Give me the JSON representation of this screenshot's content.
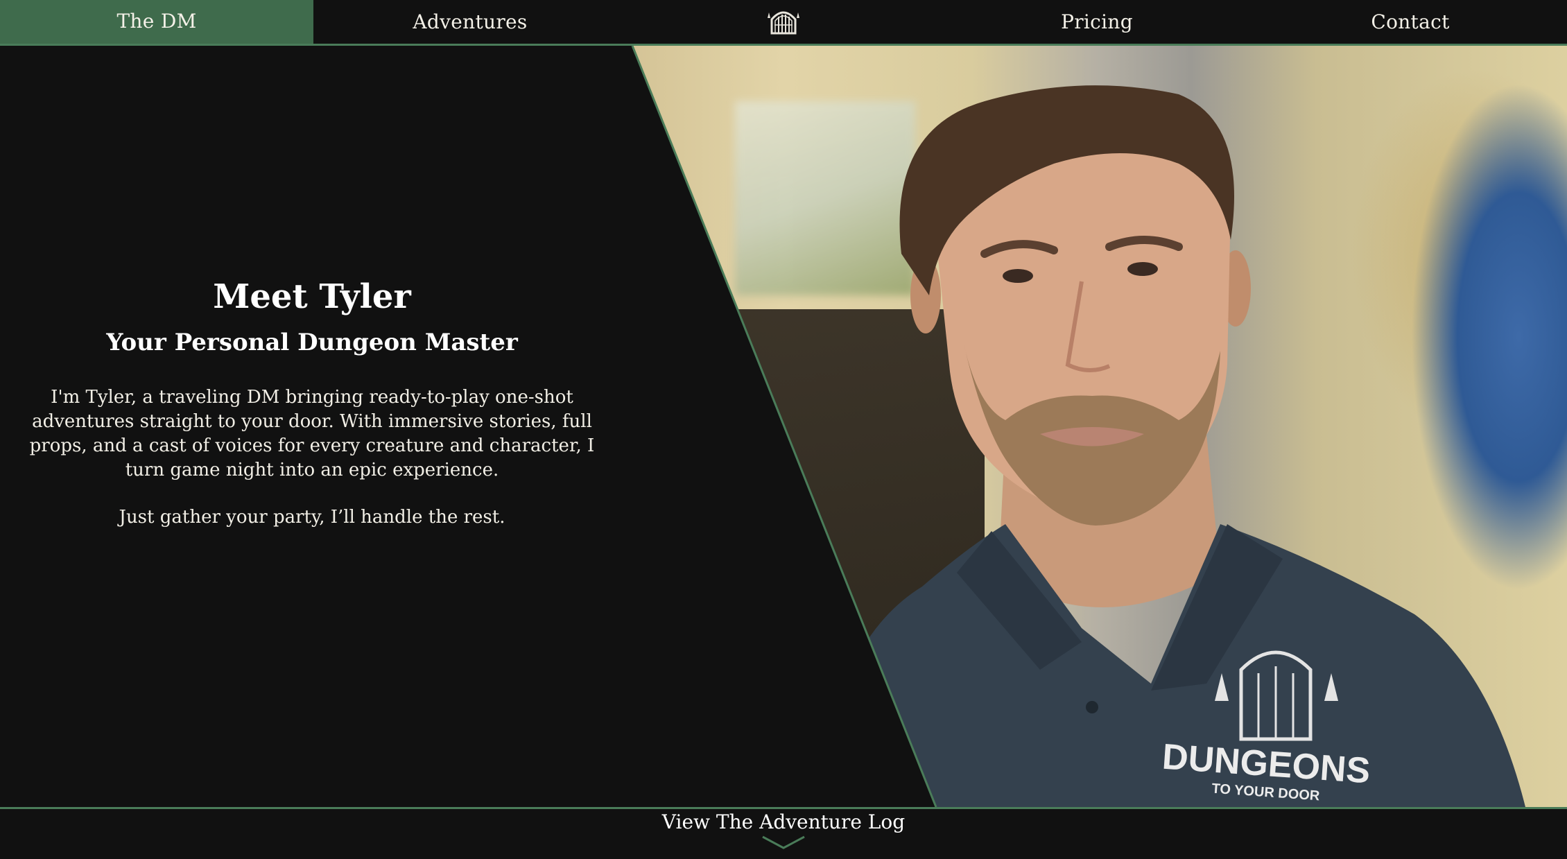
{
  "nav": {
    "items": [
      {
        "label": "The DM",
        "active": true
      },
      {
        "label": "Adventures",
        "active": false
      },
      {
        "label": "Pricing",
        "active": false
      },
      {
        "label": "Contact",
        "active": false
      }
    ],
    "logo_icon": "dungeon-door-icon"
  },
  "hero": {
    "title": "Meet Tyler",
    "subtitle": "Your Personal Dungeon Master",
    "body": "I'm Tyler, a traveling DM bringing ready-to-play one-shot adventures straight to your door. With immersive stories, full props, and a cast of voices for every creature and character, I turn game night into an epic experience.",
    "tagline": "Just gather your party, I’ll handle the rest."
  },
  "photo": {
    "shirt_logo_top": "DUNGEONS",
    "shirt_logo_bottom": "TO YOUR DOOR"
  },
  "footer": {
    "link_label": "View The Adventure Log",
    "icon": "chevron-down-icon"
  },
  "colors": {
    "background": "#111111",
    "accent_green": "#3f6b4c",
    "border_green": "#4a7c59",
    "text": "#f2efe6"
  }
}
